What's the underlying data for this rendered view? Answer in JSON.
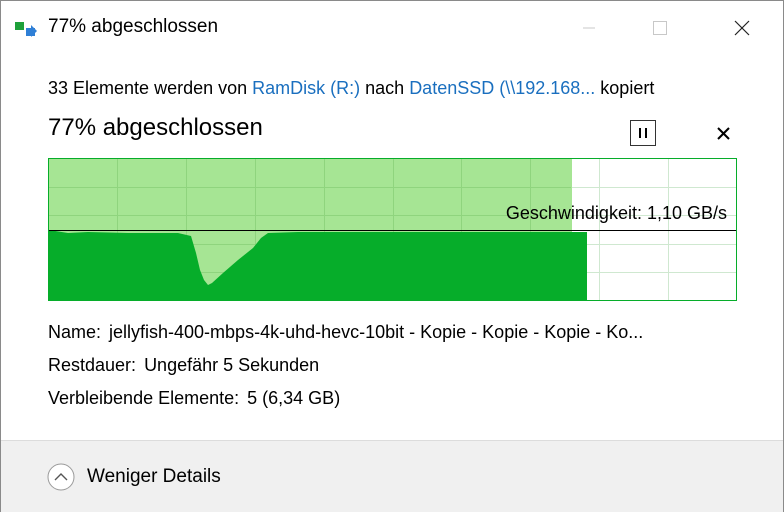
{
  "window": {
    "title": "77% abgeschlossen"
  },
  "summary": {
    "prefix": "33 Elemente werden von ",
    "source": "RamDisk (R:)",
    "middle": " nach ",
    "destination": "DatenSSD (\\\\192.168...",
    "suffix": " kopiert"
  },
  "progress": {
    "heading": "77% abgeschlossen",
    "percent": 77,
    "speed_label": "Geschwindigkeit: 1,10 GB/s"
  },
  "details": {
    "name_label": "Name:",
    "name_value": "jellyfish-400-mbps-4k-uhd-hevc-10bit - Kopie - Kopie - Kopie - Ko...",
    "remaining_time_label": "Restdauer:",
    "remaining_time_value": "Ungefähr 5 Sekunden",
    "remaining_items_label": "Verbleibende Elemente:",
    "remaining_items_value": "5 (6,34 GB)"
  },
  "footer": {
    "toggle_label": "Weniger Details"
  },
  "icons": {
    "app": "copy-transfer-icon",
    "minimize": "minimize-icon",
    "maximize": "maximize-icon",
    "close": "close-icon",
    "pause": "pause-icon",
    "cancel": "cancel-icon",
    "toggle": "chevron-up-icon"
  },
  "colors": {
    "graph_fill_light": "#a6e594",
    "graph_fill_dark": "#06ad2a",
    "link": "#1a6fbf"
  }
}
